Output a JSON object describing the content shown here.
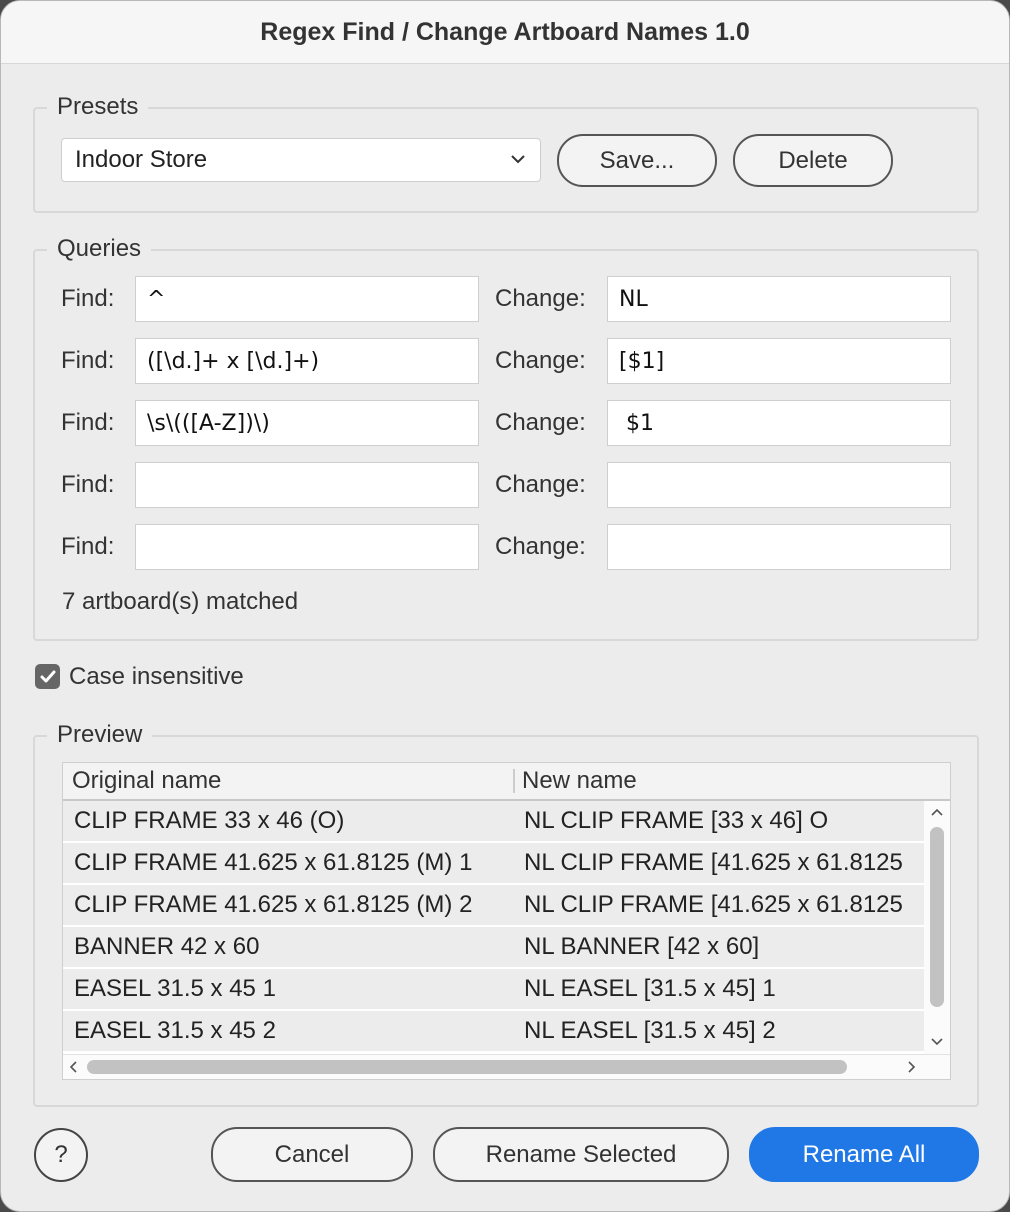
{
  "title": "Regex Find / Change Artboard Names 1.0",
  "presets": {
    "legend": "Presets",
    "selected": "Indoor Store",
    "save_label": "Save...",
    "delete_label": "Delete"
  },
  "queries": {
    "legend": "Queries",
    "find_label": "Find:",
    "change_label": "Change:",
    "rows": [
      {
        "find": "^",
        "change": "NL"
      },
      {
        "find": "([\\d.]+ x [\\d.]+)",
        "change": "[$1]"
      },
      {
        "find": "\\s\\(([A-Z])\\)",
        "change": " $1"
      },
      {
        "find": "",
        "change": ""
      },
      {
        "find": "",
        "change": ""
      }
    ],
    "match_status": "7 artboard(s) matched"
  },
  "case_insensitive": {
    "label": "Case insensitive",
    "checked": true
  },
  "preview": {
    "legend": "Preview",
    "col_original": "Original name",
    "col_new": "New name",
    "rows": [
      {
        "original": "CLIP FRAME 33 x 46 (O)",
        "new": "NL CLIP FRAME [33 x 46] O"
      },
      {
        "original": "CLIP FRAME 41.625 x 61.8125 (M) 1",
        "new": "NL CLIP FRAME [41.625 x 61.8125"
      },
      {
        "original": "CLIP FRAME 41.625 x 61.8125 (M) 2",
        "new": "NL CLIP FRAME [41.625 x 61.8125"
      },
      {
        "original": "BANNER 42 x 60",
        "new": "NL BANNER [42 x 60]"
      },
      {
        "original": "EASEL 31.5 x 45 1",
        "new": "NL EASEL [31.5 x 45] 1"
      },
      {
        "original": "EASEL 31.5 x 45 2",
        "new": "NL EASEL [31.5 x 45] 2"
      }
    ]
  },
  "footer": {
    "help_label": "?",
    "cancel_label": "Cancel",
    "rename_selected_label": "Rename Selected",
    "rename_all_label": "Rename All"
  },
  "colors": {
    "accent": "#1f78e6",
    "dialog_bg": "#ececec",
    "checkbox": "#666666"
  }
}
